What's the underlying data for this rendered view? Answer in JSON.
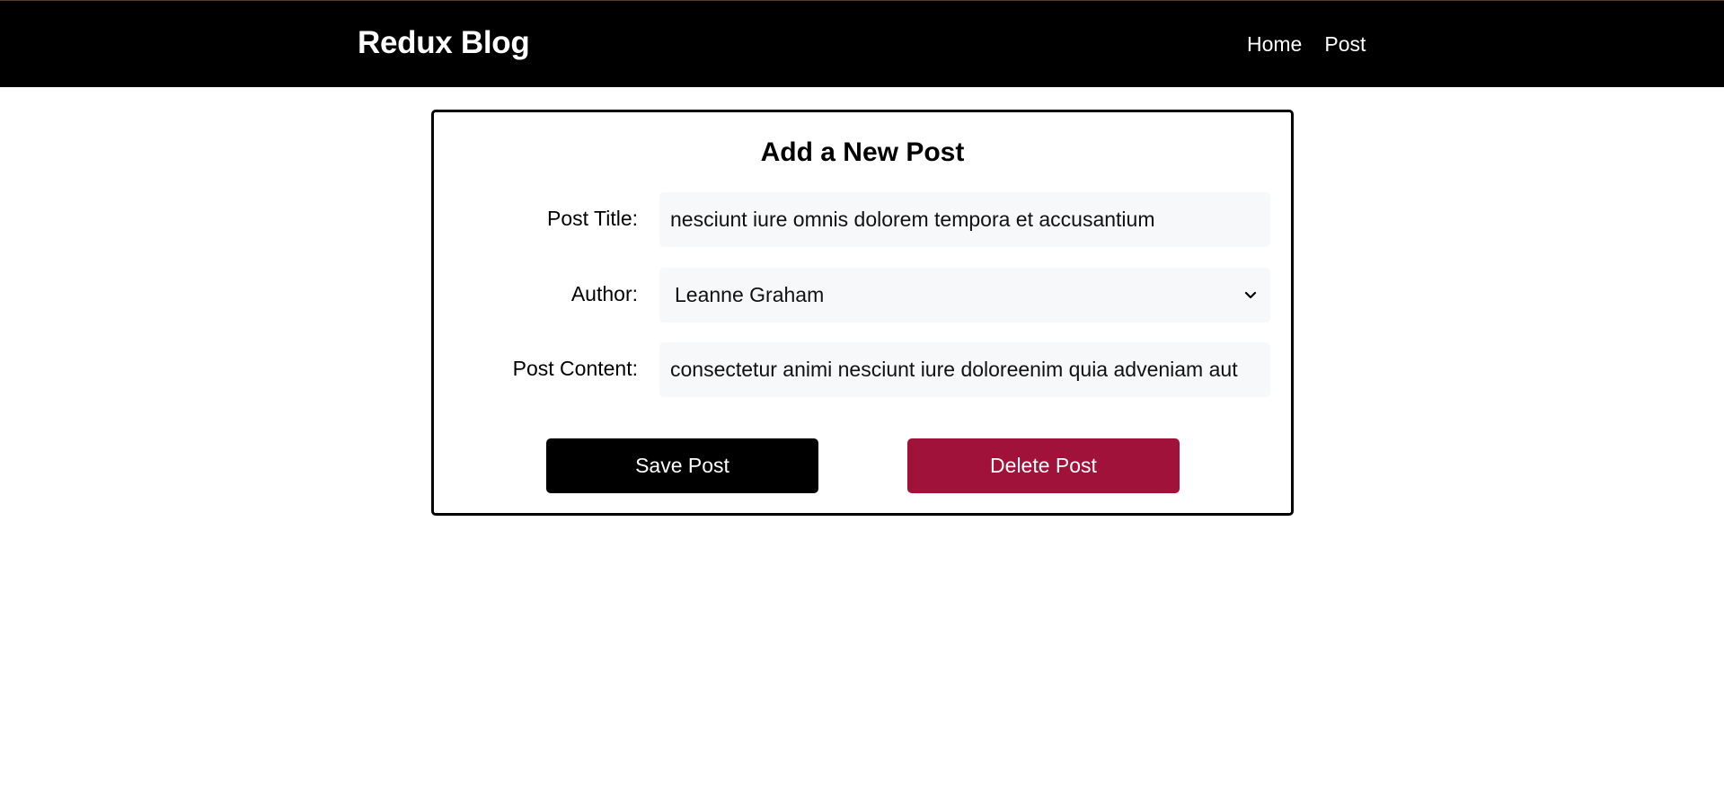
{
  "navbar": {
    "brand": "Redux Blog",
    "links": [
      "Home",
      "Post"
    ]
  },
  "form": {
    "heading": "Add a New Post",
    "title_label": "Post Title:",
    "title_value": "nesciunt iure omnis dolorem tempora et accusantium",
    "author_label": "Author:",
    "author_selected": "Leanne Graham",
    "content_label": "Post Content:",
    "content_value": "consectetur animi nesciunt iure doloreenim quia adveniam aut"
  },
  "buttons": {
    "save": "Save Post",
    "delete": "Delete Post"
  },
  "colors": {
    "navbar_bg": "#000000",
    "save_bg": "#000000",
    "delete_bg": "#a1123a",
    "field_bg": "#f7f8fa"
  }
}
